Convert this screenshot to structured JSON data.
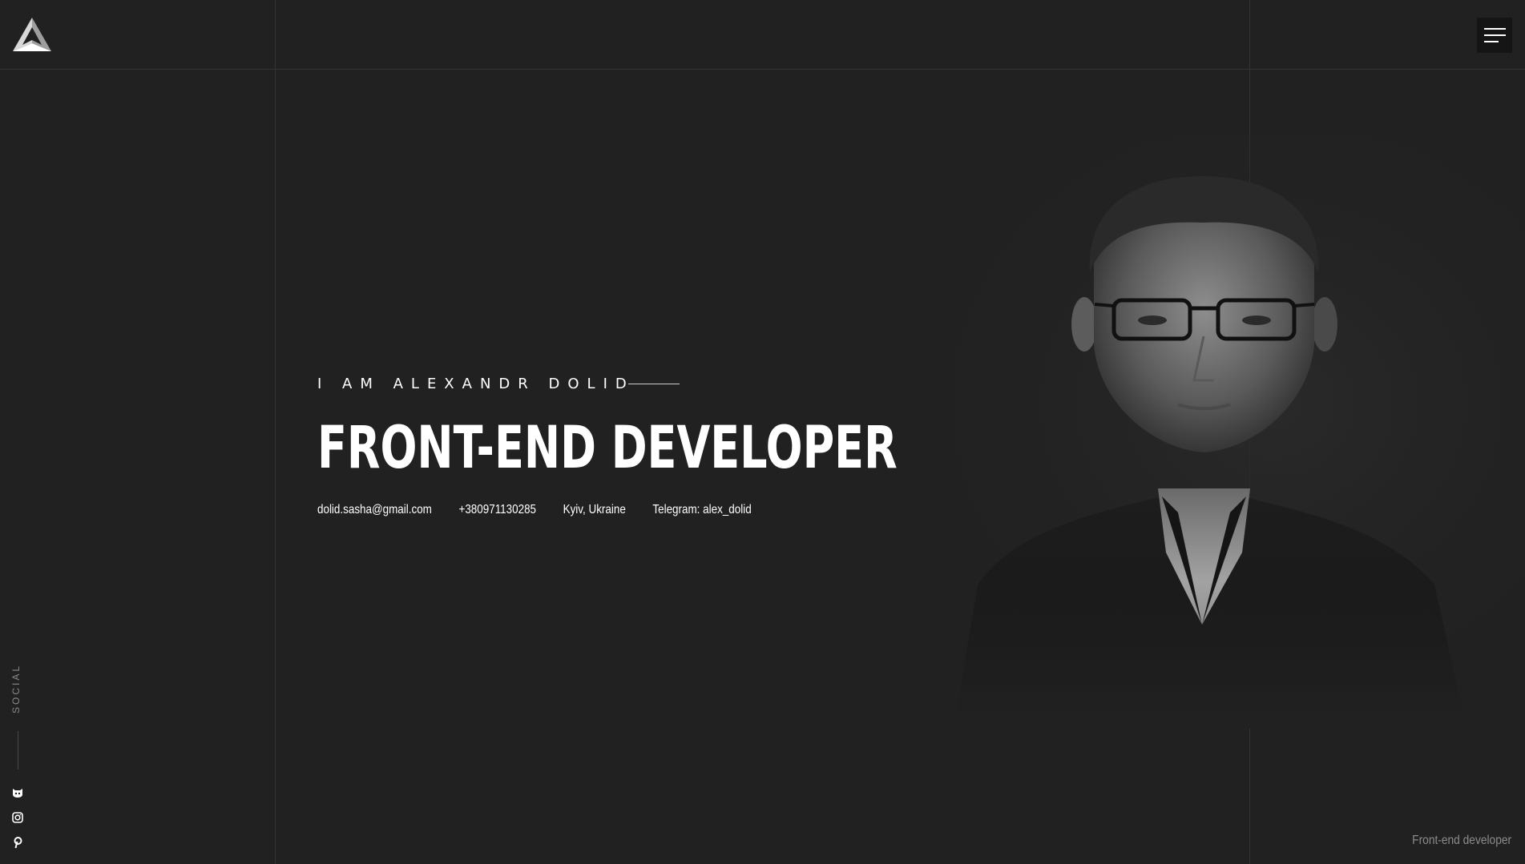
{
  "header": {
    "logo_icon": "triangle-logo-icon",
    "menu_icon": "hamburger-menu-icon"
  },
  "hero": {
    "intro": "I AM ALEXANDR DOLID",
    "headline": "FRONT-END DEVELOPER",
    "contacts": {
      "email": "dolid.sasha@gmail.com",
      "phone": "+380971130285",
      "location": "Kyiv, Ukraine",
      "telegram": "Telegram: alex_dolid"
    }
  },
  "social": {
    "label": "SOCIAL",
    "items": [
      {
        "icon": "github-icon"
      },
      {
        "icon": "instagram-icon"
      },
      {
        "icon": "pinterest-icon"
      }
    ]
  },
  "footer": {
    "tagline": "Front-end developer"
  },
  "colors": {
    "background": "#212121",
    "guide_line": "#343434",
    "text": "#ffffff",
    "muted": "#8c8c8c"
  }
}
